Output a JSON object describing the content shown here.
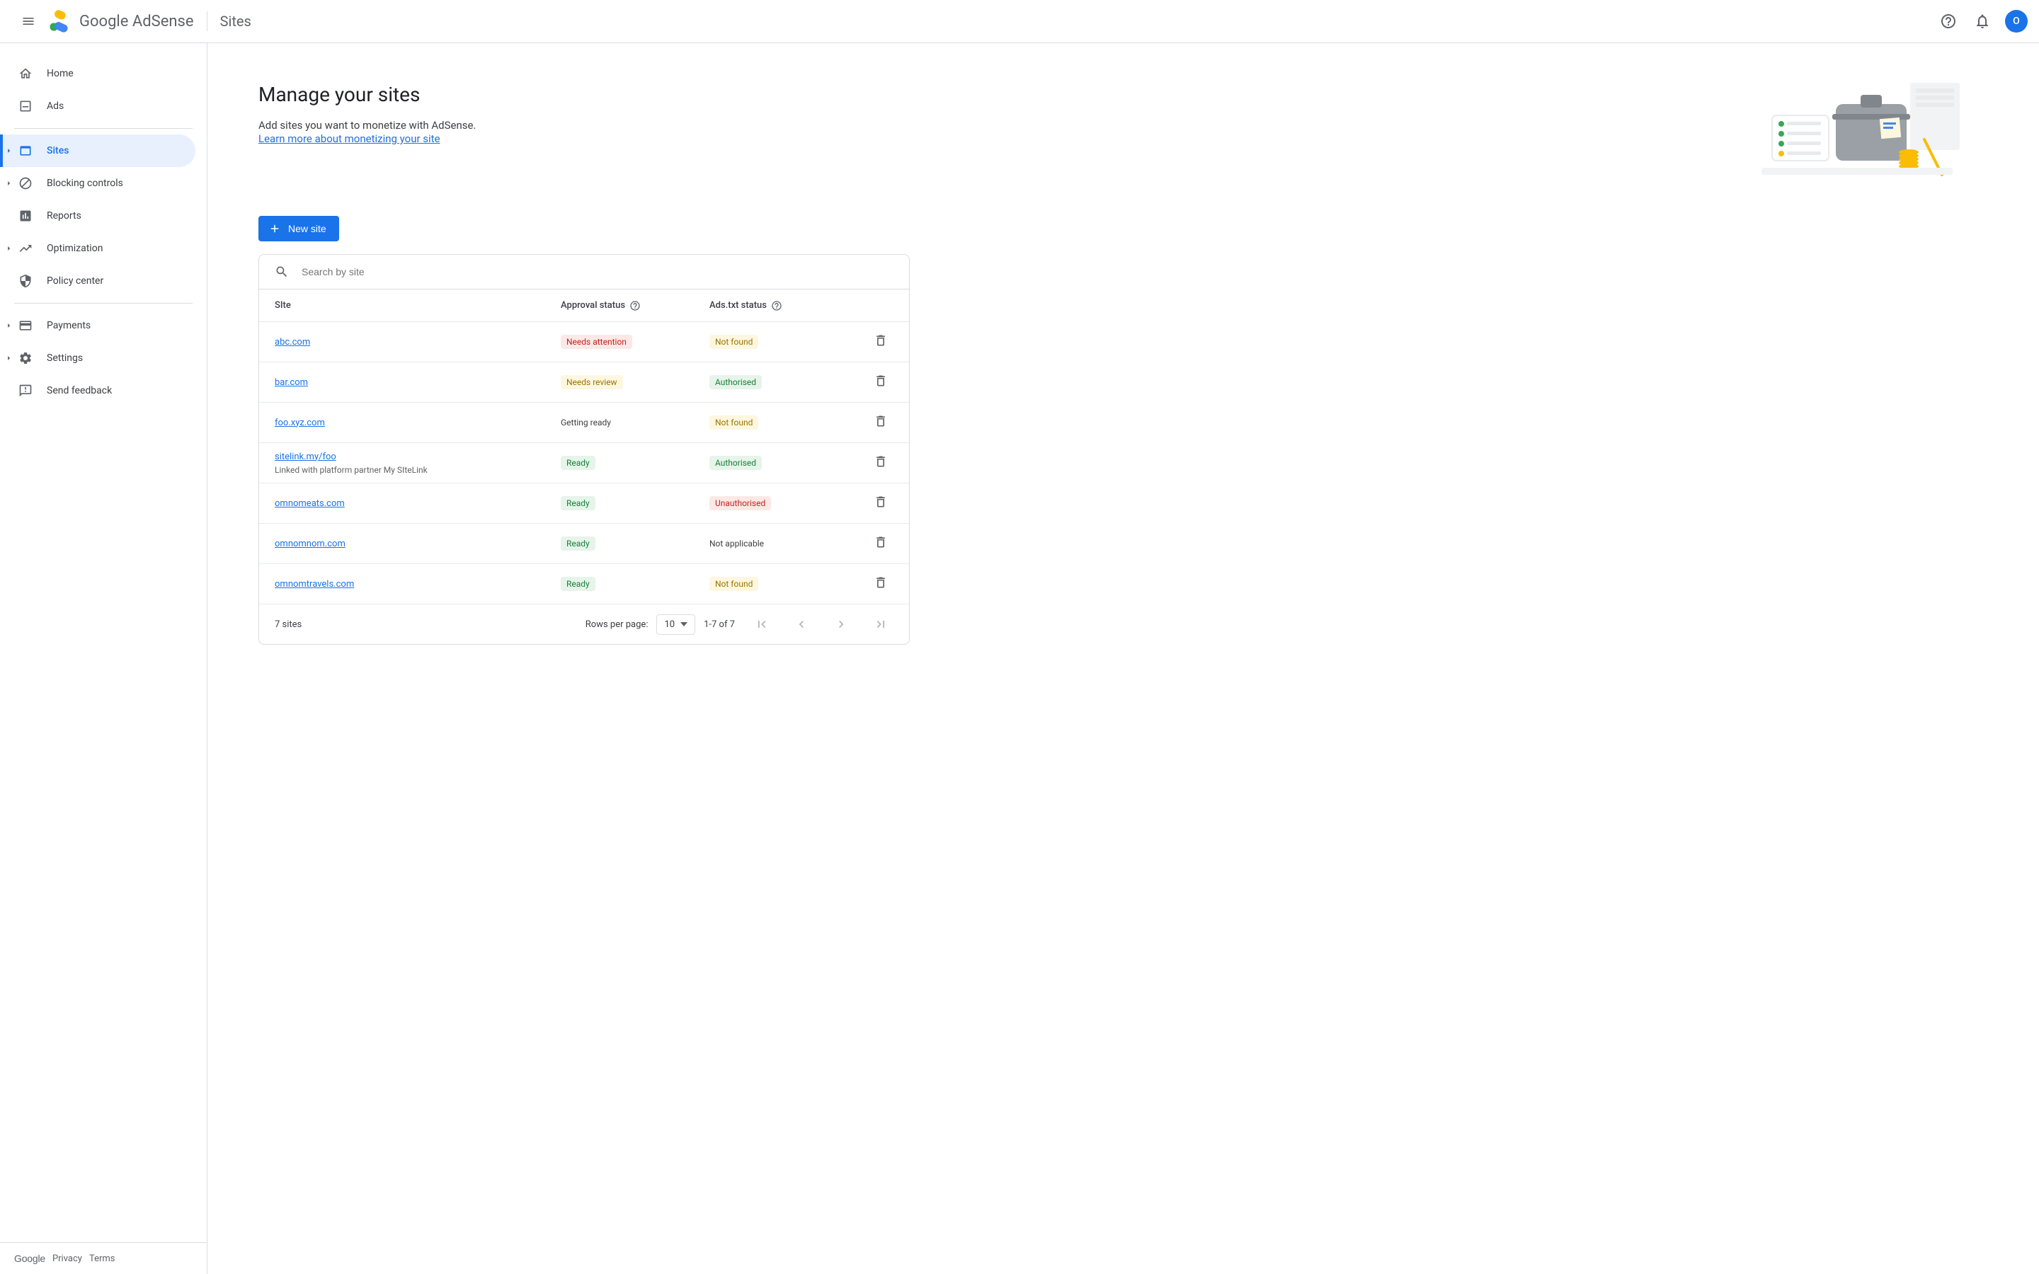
{
  "header": {
    "brand": "Google",
    "product": "AdSense",
    "section": "Sites",
    "avatar_letter": "O"
  },
  "sidebar": {
    "items": [
      {
        "label": "Home"
      },
      {
        "label": "Ads"
      },
      {
        "label": "Sites"
      },
      {
        "label": "Blocking controls"
      },
      {
        "label": "Reports"
      },
      {
        "label": "Optimization"
      },
      {
        "label": "Policy center"
      },
      {
        "label": "Payments"
      },
      {
        "label": "Settings"
      },
      {
        "label": "Send feedback"
      }
    ],
    "footer": {
      "brand": "Google",
      "privacy": "Privacy",
      "terms": "Terms"
    }
  },
  "page": {
    "title": "Manage your sites",
    "subtitle": "Add sites you want to monetize with AdSense.",
    "learn_link": "Learn more about monetizing your site",
    "new_button": "New site",
    "search_placeholder": "Search by site"
  },
  "table": {
    "columns": {
      "site": "SIte",
      "approval": "Approval status",
      "ads": "Ads.txt status"
    },
    "rows": [
      {
        "site": "abc.com",
        "subtitle": null,
        "approval": "Needs attention",
        "approval_style": "red",
        "ads": "Not found",
        "ads_style": "yellow"
      },
      {
        "site": "bar.com",
        "subtitle": null,
        "approval": "Needs review",
        "approval_style": "yellow",
        "ads": "Authorised",
        "ads_style": "green"
      },
      {
        "site": "foo.xyz.com",
        "subtitle": null,
        "approval": "Getting ready",
        "approval_style": "none",
        "ads": "Not found",
        "ads_style": "yellow"
      },
      {
        "site": "sitelink.my/foo",
        "subtitle": "Linked with platform partner My SIteLink",
        "approval": "Ready",
        "approval_style": "green",
        "ads": "Authorised",
        "ads_style": "green"
      },
      {
        "site": "omnomeats.com",
        "subtitle": null,
        "approval": "Ready",
        "approval_style": "green",
        "ads": "Unauthorised",
        "ads_style": "red"
      },
      {
        "site": "omnomnom.com",
        "subtitle": null,
        "approval": "Ready",
        "approval_style": "green",
        "ads": "Not applicable",
        "ads_style": "none"
      },
      {
        "site": "omnomtravels.com",
        "subtitle": null,
        "approval": "Ready",
        "approval_style": "green",
        "ads": "Not found",
        "ads_style": "yellow"
      }
    ],
    "footer": {
      "count": "7 sites",
      "rows_per_page_label": "Rows per page:",
      "rows_per_page_value": "10",
      "range": "1-7 of 7"
    }
  }
}
